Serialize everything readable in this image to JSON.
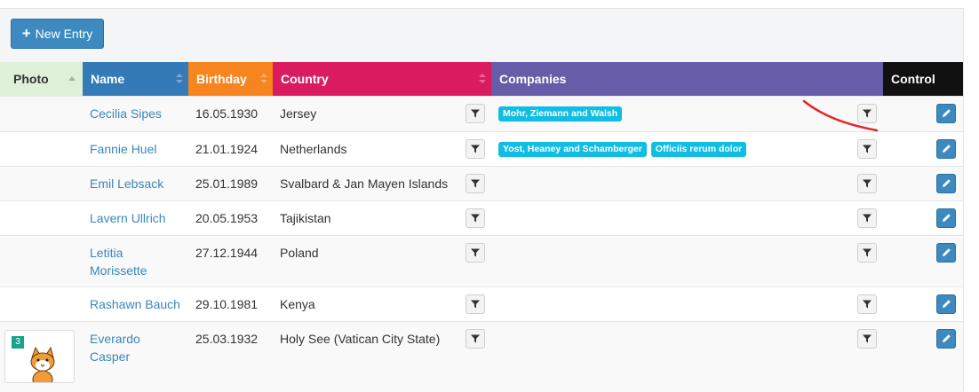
{
  "toolbar": {
    "new_entry_label": "New Entry",
    "new_entry_icon": "plus-icon"
  },
  "columns": {
    "photo": {
      "label": "Photo",
      "bg": "#dff0d8",
      "color": "#333333"
    },
    "name": {
      "label": "Name",
      "bg": "#337ab7"
    },
    "birthday": {
      "label": "Birthday",
      "bg": "#f6851f"
    },
    "country": {
      "label": "Country",
      "bg": "#da1b5f"
    },
    "companies": {
      "label": "Companies",
      "bg": "#655da8"
    },
    "control": {
      "label": "Control",
      "bg": "#111111"
    }
  },
  "rows": [
    {
      "name": "Cecilia Sipes",
      "birthday": "16.05.1930",
      "country": "Jersey",
      "companies": [
        "Mohr, Ziemann and Walsh"
      ]
    },
    {
      "name": "Fannie Huel",
      "birthday": "21.01.1924",
      "country": "Netherlands",
      "companies": [
        "Yost, Heaney and Schamberger",
        "Officiis rerum dolor"
      ]
    },
    {
      "name": "Emil Lebsack",
      "birthday": "25.01.1989",
      "country": "Svalbard & Jan Mayen Islands",
      "companies": []
    },
    {
      "name": "Lavern Ullrich",
      "birthday": "20.05.1953",
      "country": "Tajikistan",
      "companies": []
    },
    {
      "name": "Letitia Morissette",
      "birthday": "27.12.1944",
      "country": "Poland",
      "companies": []
    },
    {
      "name": "Rashawn Bauch",
      "birthday": "29.10.1981",
      "country": "Kenya",
      "companies": []
    },
    {
      "name": "Everardo Casper",
      "birthday": "25.03.1932",
      "country": "Holy See (Vatican City State)",
      "companies": [],
      "photo_badge": "3"
    }
  ],
  "colors": {
    "accent": "#3d8ac0",
    "badge": "#12bde4",
    "link": "#3a87b8",
    "annotation": "#e0262b"
  }
}
